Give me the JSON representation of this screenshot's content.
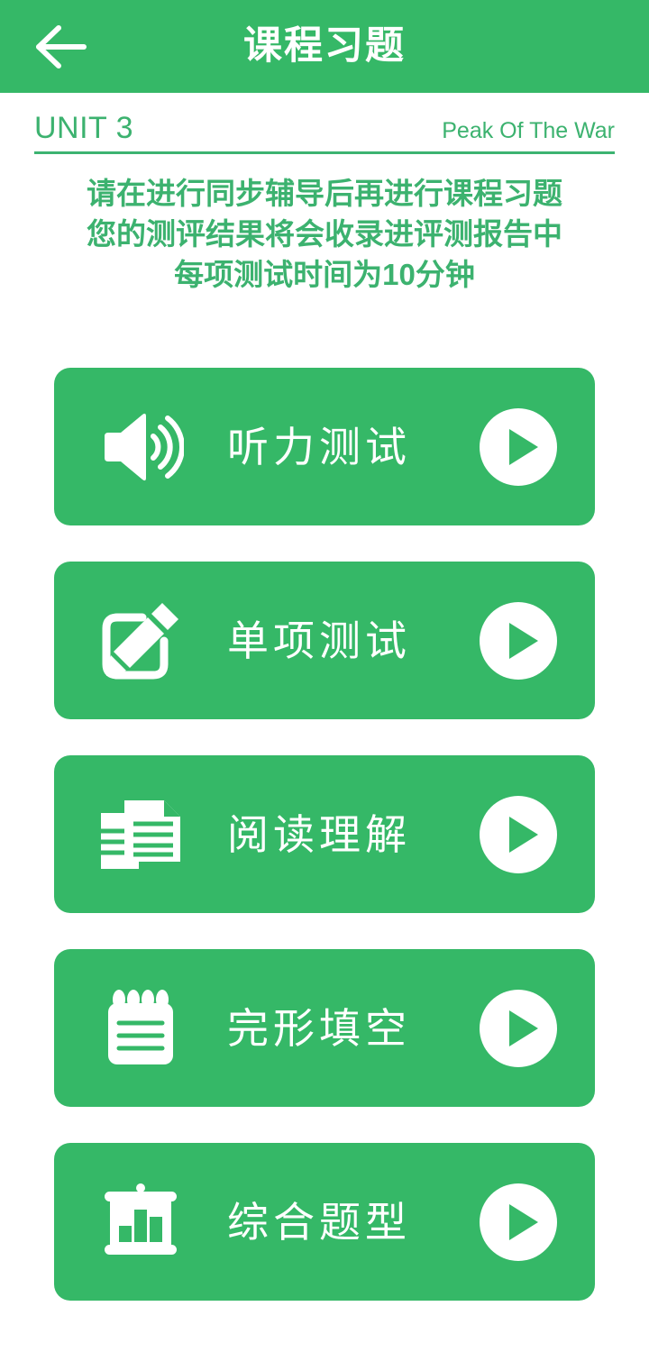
{
  "header": {
    "title": "课程习题",
    "back_icon": "arrow-left-icon"
  },
  "unit": {
    "label": "UNIT 3",
    "subtitle": "Peak Of The War"
  },
  "description": {
    "line1": "请在进行同步辅导后再进行课程习题",
    "line2": "您的测评结果将会收录进评测报告中",
    "line3": "每项测试时间为10分钟"
  },
  "colors": {
    "brand_green": "#35b867",
    "text_green": "#3cb26f",
    "white": "#ffffff"
  },
  "tests": [
    {
      "label": "听力测试",
      "icon": "speaker-volume-icon",
      "play_icon": "play-circle-icon"
    },
    {
      "label": "单项测试",
      "icon": "edit-pencil-square-icon",
      "play_icon": "play-circle-icon"
    },
    {
      "label": "阅读理解",
      "icon": "documents-icon",
      "play_icon": "play-circle-icon"
    },
    {
      "label": "完形填空",
      "icon": "notepad-icon",
      "play_icon": "play-circle-icon"
    },
    {
      "label": "综合题型",
      "icon": "presentation-chart-icon",
      "play_icon": "play-circle-icon"
    }
  ]
}
